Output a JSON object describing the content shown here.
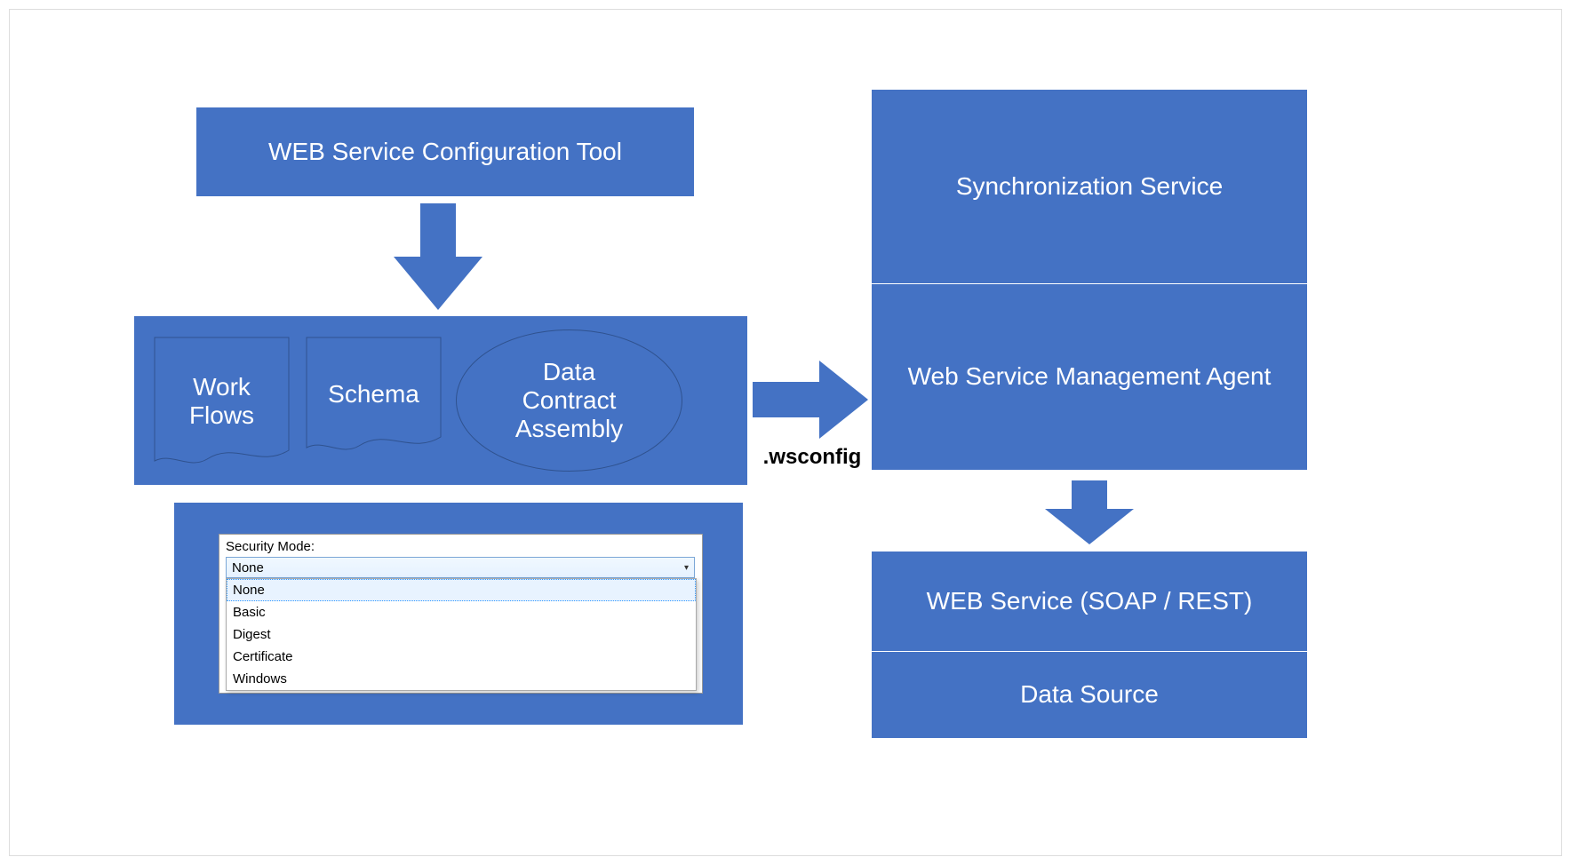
{
  "diagram": {
    "configTool": "WEB Service Configuration Tool",
    "container": {
      "workFlows": "Work\nFlows",
      "schema": "Schema",
      "dataContractAssembly": "Data\nContract\nAssembly"
    },
    "wsconfigLabel": ".wsconfig",
    "rightColumn": {
      "sync": "Synchronization Service",
      "agent": "Web Service Management Agent",
      "web": "WEB Service (SOAP / REST)",
      "dataSource": "Data Source"
    },
    "securityMode": {
      "label": "Security Mode:",
      "selected": "None",
      "options": [
        "None",
        "Basic",
        "Digest",
        "Certificate",
        "Windows"
      ]
    }
  }
}
